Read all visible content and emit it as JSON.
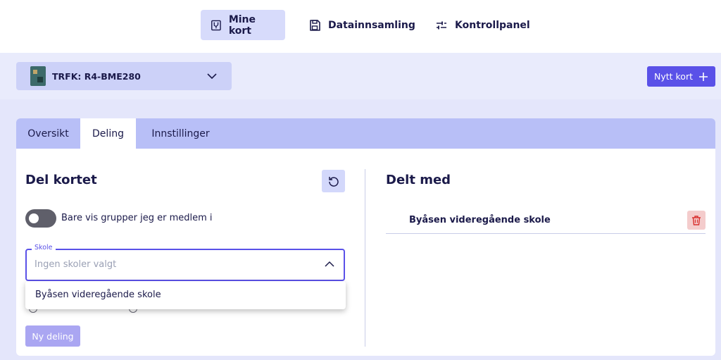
{
  "nav": {
    "items": [
      {
        "label": "Mine kort",
        "icon": "board-icon",
        "active": true
      },
      {
        "label": "Datainnsamling",
        "icon": "save-icon",
        "active": false
      },
      {
        "label": "Kontrollpanel",
        "icon": "sliders-icon",
        "active": false
      }
    ]
  },
  "board_selector": {
    "label": "TRFK: R4-BME280",
    "icon": "arduino-board-icon"
  },
  "new_card_button": {
    "label": "Nytt kort",
    "icon": "plus-icon"
  },
  "tabs": [
    {
      "label": "Oversikt",
      "active": false
    },
    {
      "label": "Deling",
      "active": true
    },
    {
      "label": "Innstillinger",
      "active": false
    }
  ],
  "share_panel": {
    "title": "Del kortet",
    "reset_icon": "reset-icon",
    "toggle_label": "Bare vis grupper jeg er medlem i",
    "toggle_on": false,
    "school_field": {
      "legend": "Skole",
      "placeholder": "Ingen skoler valgt"
    },
    "dropdown_options": [
      "Byåsen videregående skole"
    ],
    "share_button": "Ny deling"
  },
  "shared_with": {
    "title": "Delt med",
    "entries": [
      {
        "name": "Byåsen videregående skole",
        "delete_icon": "trash-icon"
      }
    ]
  },
  "colors": {
    "accent": "#5a51e8",
    "nav_active_bg": "#d7dbfb",
    "tab_bar": "#b8bff7",
    "page_bg": "#e4e6fb",
    "delete_bg": "#f4cccc",
    "delete_icon": "#d9302f",
    "text": "#1b1a4a"
  }
}
